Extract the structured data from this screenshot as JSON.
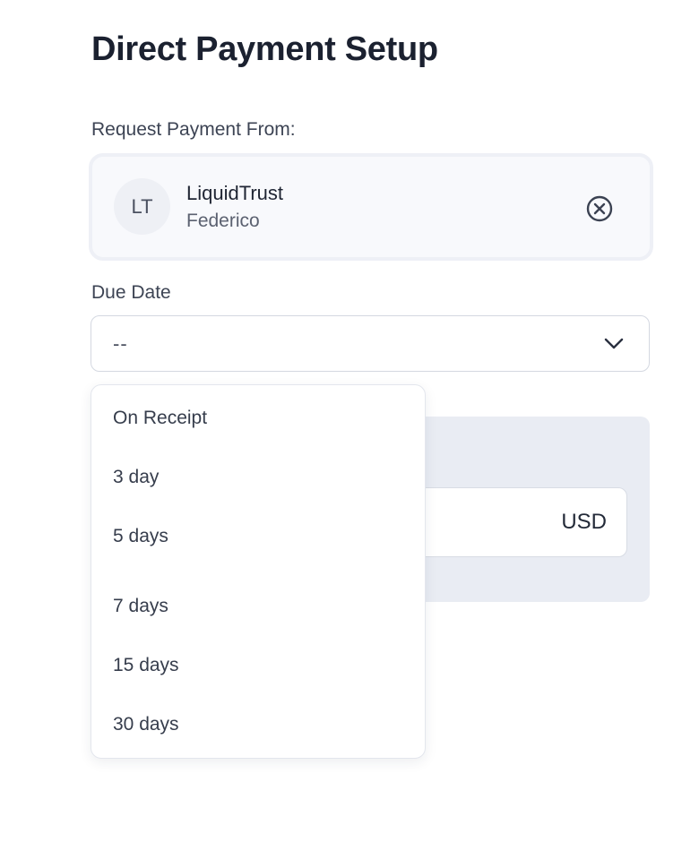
{
  "page": {
    "title": "Direct Payment Setup"
  },
  "request_from": {
    "label": "Request Payment From:",
    "payer": {
      "initials": "LT",
      "name": "LiquidTrust",
      "contact": "Federico"
    }
  },
  "due_date": {
    "label": "Due Date",
    "value": "--",
    "options": [
      "On Receipt",
      "3 day",
      "5 days",
      "7 days",
      "15 days",
      "30 days"
    ]
  },
  "amount": {
    "currency": "USD"
  },
  "icons": {
    "remove": "close-circle-icon",
    "dropdown": "chevron-down-icon"
  },
  "colors": {
    "text": "#1b2130",
    "panel": "#e9ecf3",
    "card": "#f8f9fc"
  }
}
